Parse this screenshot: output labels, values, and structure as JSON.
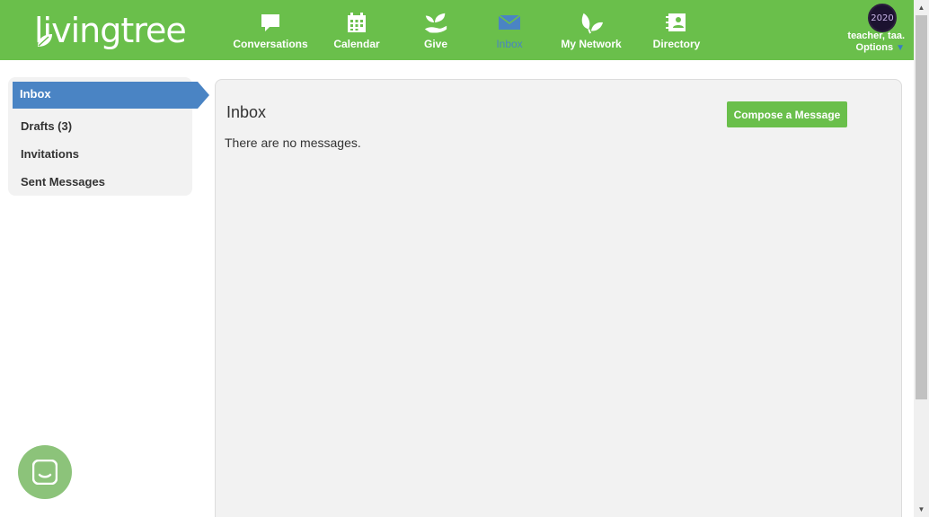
{
  "brand": {
    "logo_text": "livingtree",
    "color": "#6abf4b"
  },
  "nav": {
    "items": [
      {
        "label": "Conversations",
        "icon": "chat-bubble-icon"
      },
      {
        "label": "Calendar",
        "icon": "calendar-icon"
      },
      {
        "label": "Give",
        "icon": "hand-plant-icon"
      },
      {
        "label": "Inbox",
        "icon": "envelope-icon",
        "active": true
      },
      {
        "label": "My Network",
        "icon": "leaves-icon"
      },
      {
        "label": "Directory",
        "icon": "contact-book-icon"
      }
    ],
    "active_color": "#4a84c4"
  },
  "user": {
    "name": "teacher, taa.",
    "options_label": "Options",
    "avatar_text": "2020"
  },
  "sidebar": {
    "items": [
      {
        "label": "Inbox",
        "active": true
      },
      {
        "label": "Drafts (3)"
      },
      {
        "label": "Invitations"
      },
      {
        "label": "Sent Messages"
      }
    ]
  },
  "main": {
    "title": "Inbox",
    "compose_label": "Compose a Message",
    "empty_text": "There are no messages."
  },
  "scrollbar": {
    "up_arrow": "▲",
    "down_arrow": "▼"
  },
  "chat_launcher": {
    "icon": "chat-smile-icon"
  }
}
